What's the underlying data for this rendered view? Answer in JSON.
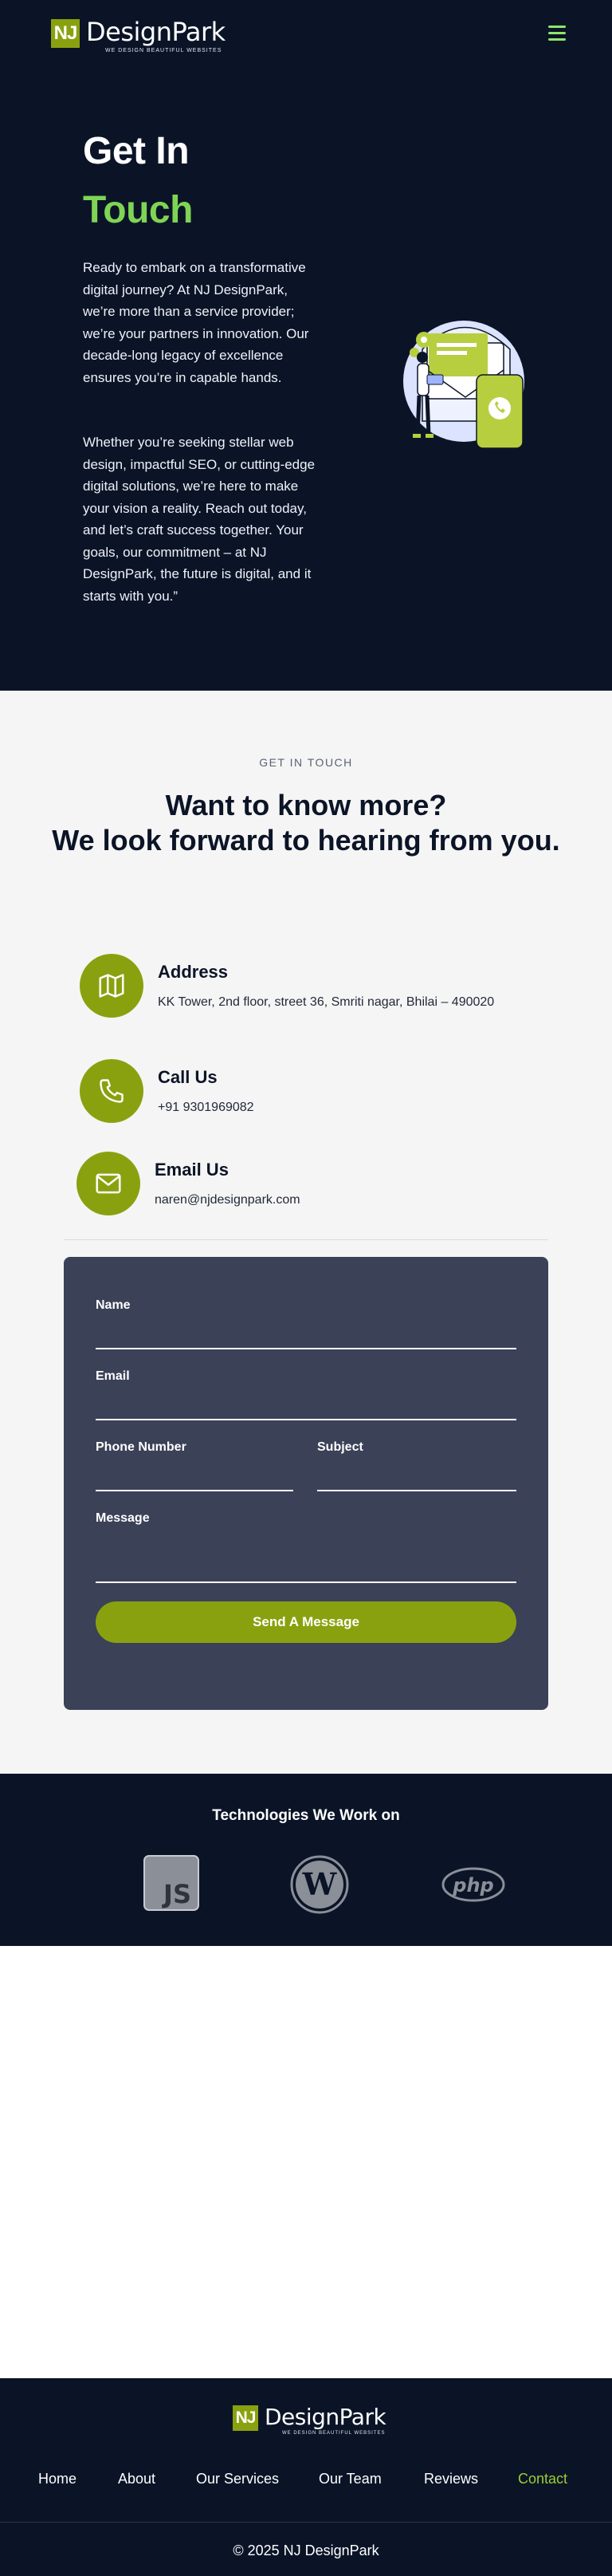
{
  "brand": {
    "mark": "NJ",
    "name": "DesignPark",
    "tagline": "WE DESIGN BEAUTIFUL WEBSITES"
  },
  "hero": {
    "title_line1": "Get In",
    "title_line2": "Touch",
    "paragraph1": "Ready to embark on a transformative digital journey? At NJ DesignPark, we’re more than a service provider; we’re your partners in innovation. Our decade-long legacy of excellence ensures you’re in capable hands.",
    "paragraph2": "Whether you’re seeking stellar web design, impactful SEO, or cutting-edge digital solutions, we’re here to make your vision a reality. Reach out today, and let’s craft success together. Your goals, our commitment – at NJ DesignPark, the future is digital, and it starts with you.”"
  },
  "contact": {
    "eyebrow": "GET IN TOUCH",
    "heading_line1": "Want to know more?",
    "heading_line2": "We look forward to hearing from you.",
    "address_title": "Address",
    "address_text": "KK Tower, 2nd floor, street 36, Smriti nagar, Bhilai – 490020",
    "phone_title": "Call Us",
    "phone_text": "+91 9301969082",
    "email_title": "Email Us",
    "email_text": "naren@njdesignpark.com"
  },
  "form": {
    "name_label": "Name",
    "email_label": "Email",
    "phone_label": "Phone Number",
    "subject_label": "Subject",
    "message_label": "Message",
    "submit_label": "Send A Message"
  },
  "tech": {
    "title": "Technologies We Work on",
    "logos": [
      "js-icon",
      "wordpress-icon",
      "php-icon"
    ],
    "js_text": "JS",
    "php_text": "php"
  },
  "footer": {
    "nav": [
      "Home",
      "About",
      "Our Services",
      "Our Team",
      "Reviews",
      "Contact"
    ],
    "active_nav": "Contact",
    "copyright": "© 2025 NJ DesignPark"
  },
  "colors": {
    "navy": "#0b1427",
    "accent_olive": "#8aa10f",
    "accent_green": "#7fd455",
    "form_bg": "#3b4157",
    "section_bg": "#f5f5f5"
  }
}
